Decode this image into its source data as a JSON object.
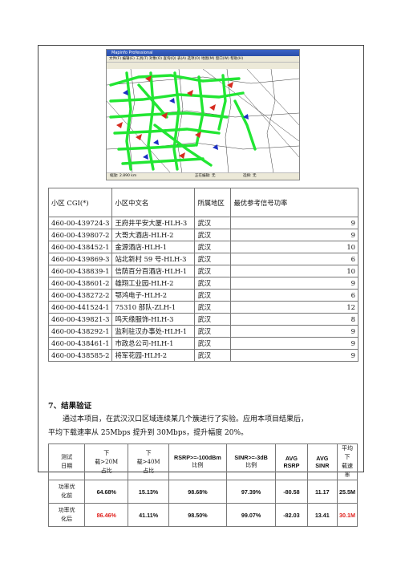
{
  "screenshot": {
    "title": "Mapinfo Professional",
    "menu": "文件(F)  编辑(E)  工具(T)  对象(O)  查询(Q)  表(A)  选项(O)  地图(M)  窗口(W)  帮助(H)",
    "subtitle": "小区信息图层,... 地图",
    "status_zoom": "缩放: 2.890 km",
    "status_edit": "正在编辑: 无",
    "status_select": "选择: 无",
    "colors": {
      "road": "#22e633",
      "sector_red": "#d62b1f",
      "sector_blue": "#1c2fc4",
      "line": "#3b3b3b"
    }
  },
  "cell_table": {
    "headers": [
      "小区 CGI(*)",
      "小区中文名",
      "所属地区",
      "最优参考信号功率"
    ],
    "rows": [
      [
        "460-00-439724-3",
        "王府井平安大厦-HLH-3",
        "武汉",
        "9"
      ],
      [
        "460-00-439807-2",
        "大哥大酒店-HLH-2",
        "武汉",
        "9"
      ],
      [
        "460-00-438452-1",
        "金源酒店-HLH-1",
        "武汉",
        "10"
      ],
      [
        "460-00-439869-3",
        "站北新村 59 号-HLH-3",
        "武汉",
        "6"
      ],
      [
        "460-00-438839-1",
        "信荫百分百酒店-HLH-1",
        "武汉",
        "10"
      ],
      [
        "460-00-438601-2",
        "雄翔工业园-HLH-2",
        "武汉",
        "9"
      ],
      [
        "460-00-438272-2",
        "鄂鸿电子-HLH-2",
        "武汉",
        "6"
      ],
      [
        "460-00-441524-1",
        "75310 部队-ZLH-1",
        "武汉",
        "12"
      ],
      [
        "460-00-439821-3",
        "鸣天缘服饰-HLH-3",
        "武汉",
        "8"
      ],
      [
        "460-00-438292-1",
        "监利驻汉办事处-HLH-1",
        "武汉",
        "9"
      ],
      [
        "460-00-438461-1",
        "市政总公司-HLH-1",
        "武汉",
        "9"
      ],
      [
        "460-00-438585-2",
        "将军花园-HLH-2",
        "武汉",
        "9"
      ]
    ]
  },
  "section": {
    "title": "7、结果验证",
    "line1": "　　通过本项目，在武汉汉口区域连续某几个簇进行了实验。应用本项目结果后，",
    "line2": "平均下载速率从 25Mbps 提升到 30Mbps，提升幅度 20%。"
  },
  "summary_table": {
    "headers": [
      {
        "cn1": "测试",
        "cn2": "日期"
      },
      {
        "cn1": "下",
        "cn2": "载>20M",
        "cn3": "占比"
      },
      {
        "cn1": "下",
        "cn2": "载>40M",
        "cn3": "占比"
      },
      {
        "en": "RSRP>=-100dBm",
        "cn": "比例"
      },
      {
        "en": "SINR>=-3dB",
        "cn": "比例"
      },
      {
        "en1": "AVG",
        "en2": "RSRP"
      },
      {
        "en1": "AVG",
        "en2": "SINR"
      },
      {
        "cn1": "平均下",
        "cn2": "载速率"
      }
    ],
    "rows": [
      {
        "label1": "功率优",
        "label2": "化前",
        "values": [
          "64.68%",
          "15.13%",
          "98.68%",
          "97.39%",
          "-80.58",
          "11.17",
          "25.5M"
        ]
      },
      {
        "label1": "功率优",
        "label2": "化后",
        "values": [
          "86.46%",
          "41.11%",
          "98.50%",
          "99.07%",
          "-82.03",
          "13.41",
          "30.1M"
        ]
      }
    ],
    "highlight_color": "#e0201c"
  }
}
